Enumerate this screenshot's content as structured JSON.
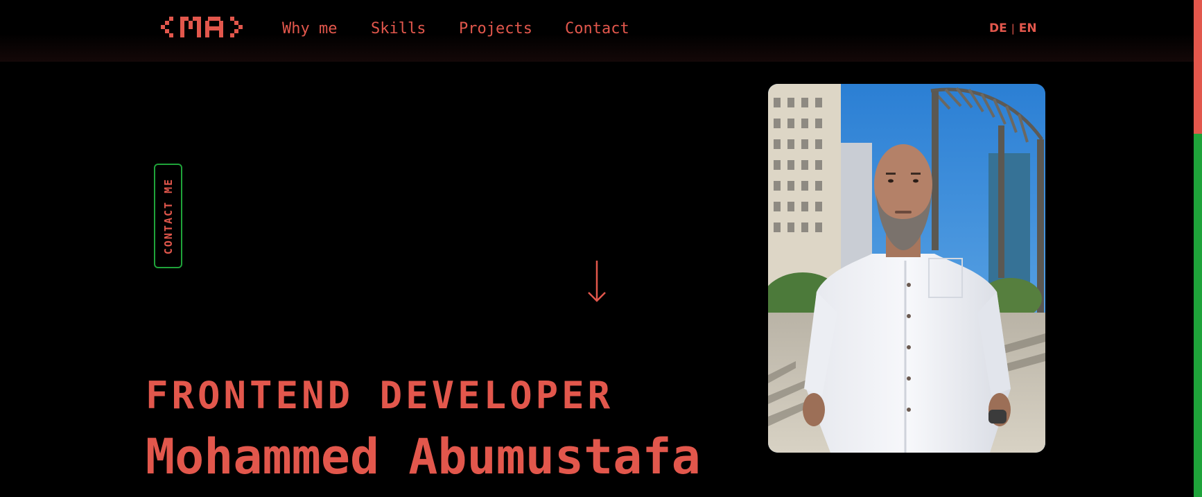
{
  "brand": {
    "logo_text": "<MA>"
  },
  "nav": {
    "items": [
      {
        "label": "Why me"
      },
      {
        "label": "Skills"
      },
      {
        "label": "Projects"
      },
      {
        "label": "Contact"
      }
    ]
  },
  "language": {
    "options": [
      "DE",
      "EN"
    ],
    "separator": "|"
  },
  "hero": {
    "contact_label": "CONTACT ME",
    "role": "FRONTEND DEVELOPER",
    "name": "Mohammed Abumustafa",
    "scroll_indicator_icon": "arrow-down-icon",
    "portrait_icon": "portrait-photo"
  },
  "colors": {
    "background": "#000000",
    "accent": "#e2574c",
    "green": "#1fa33a"
  }
}
